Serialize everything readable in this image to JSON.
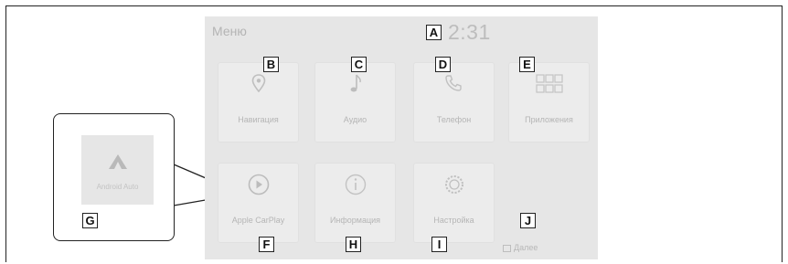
{
  "screen": {
    "menu_title": "Меню",
    "clock": "2:31"
  },
  "tiles": [
    {
      "id": "navigation",
      "label": "Навигация",
      "icon": "map-pin-icon",
      "tag": "B"
    },
    {
      "id": "audio",
      "label": "Аудио",
      "icon": "music-note-icon",
      "tag": "C"
    },
    {
      "id": "phone",
      "label": "Телефон",
      "icon": "phone-icon",
      "tag": "D"
    },
    {
      "id": "apps",
      "label": "Приложения",
      "icon": "grid-icon",
      "tag": "E"
    },
    {
      "id": "apple-carplay",
      "label": "Apple CarPlay",
      "icon": "play-circle-icon",
      "tag": "F"
    },
    {
      "id": "information",
      "label": "Информация",
      "icon": "info-icon",
      "tag": "H"
    },
    {
      "id": "settings",
      "label": "Настройка",
      "icon": "gear-icon",
      "tag": "I"
    }
  ],
  "end_button": {
    "label": "Далее",
    "tag": "J"
  },
  "callout": {
    "label": "Android Auto",
    "icon": "android-auto-icon",
    "tag": "G"
  },
  "clock_tag": "A"
}
